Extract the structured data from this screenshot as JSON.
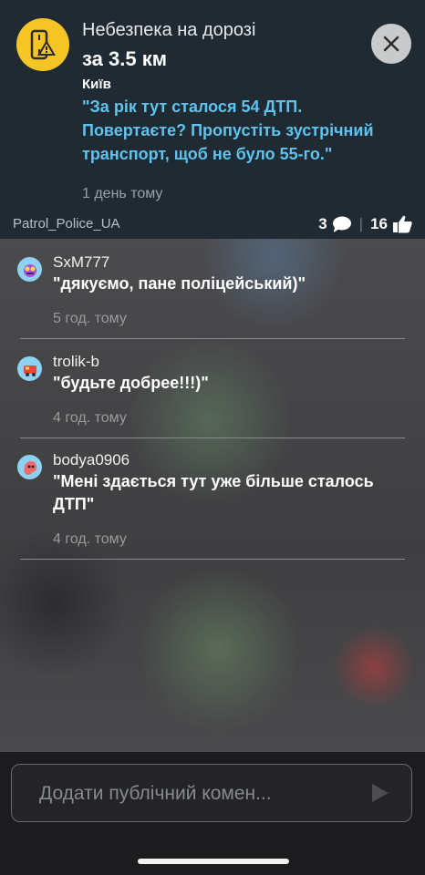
{
  "header": {
    "title": "Небезпека на дорозі",
    "distance": "за 3.5 км",
    "city": "Київ",
    "message": "\"За рік тут сталося 54 ДТП. Повертаєте? Пропустіть зустрічний транспорт, щоб не було 55-го.\"",
    "time": "1 день тому",
    "author": "Patrol_Police_UA",
    "comment_count": "3",
    "like_count": "16",
    "icon": "road-hazard-warning-icon",
    "accent_color": "#f5c526",
    "message_color": "#5ec3ee"
  },
  "comments": [
    {
      "user": "SxM777",
      "text": "\"дякуємо, пане поліцейський)\"",
      "time": "5 год. тому"
    },
    {
      "user": "trolik-b",
      "text": "\"будьте добрее!!!)\"",
      "time": "4 год. тому"
    },
    {
      "user": "bodya0906",
      "text": "\"Мені здається тут уже більше сталось ДТП\"",
      "time": "4 год. тому"
    }
  ],
  "input": {
    "placeholder": "Додати публічний комен..."
  }
}
